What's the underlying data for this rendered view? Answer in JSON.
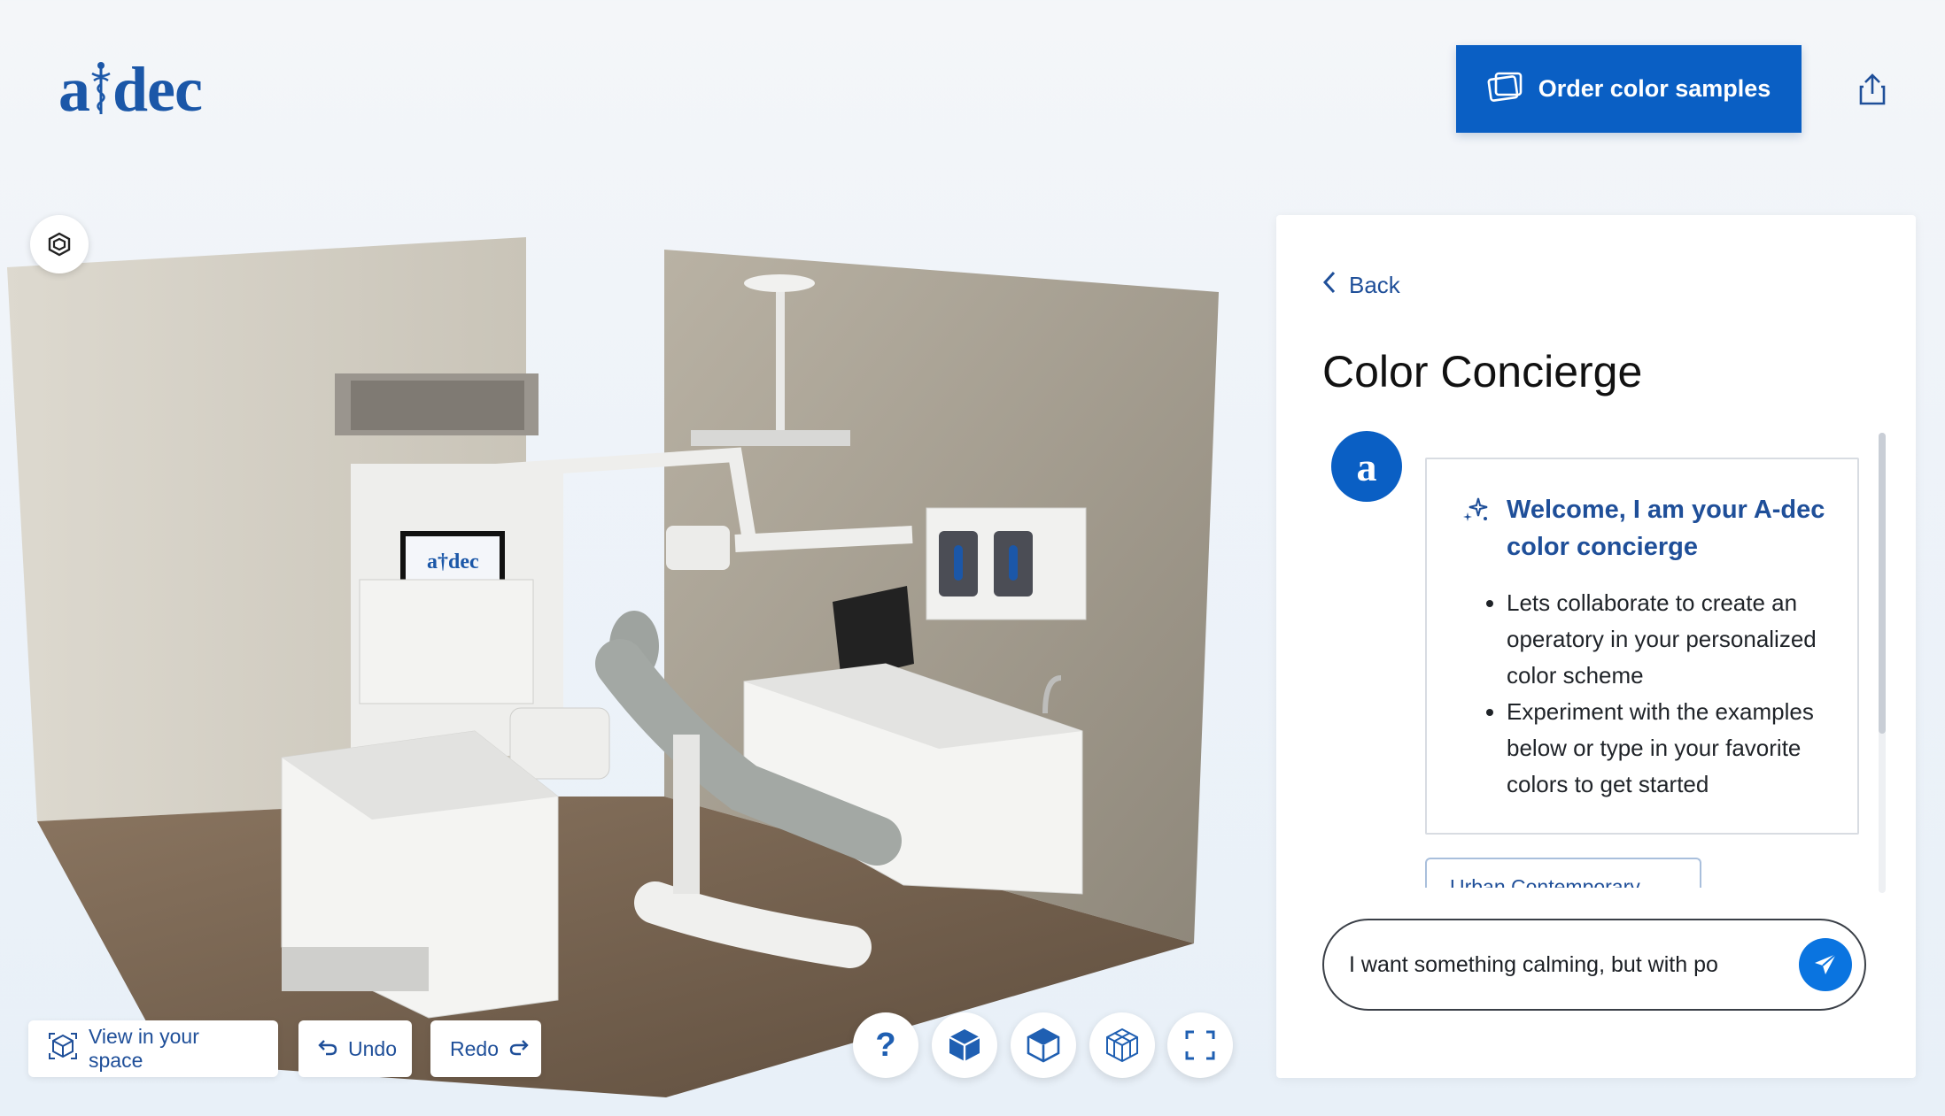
{
  "header": {
    "logo_text_left": "a",
    "logo_text_right": "dec",
    "order_button_label": "Order color samples",
    "order_icon": "swatch-icon",
    "share_icon": "share-icon"
  },
  "viewport": {
    "ar_icon": "ar-icon",
    "monitor_logo": "a†dec",
    "bottom_buttons": {
      "view_in_space": "View in your space",
      "undo": "Undo",
      "redo": "Redo"
    },
    "tools": {
      "help": "?",
      "cube_icons": [
        "cube-solid-icon",
        "cube-top-icon",
        "cube-wireframe-icon"
      ],
      "fullscreen_icon": "fullscreen-icon"
    }
  },
  "panel": {
    "back_label": "Back",
    "title": "Color Concierge",
    "avatar_letter": "a",
    "welcome_title": "Welcome, I am your A-dec color concierge",
    "bullets": [
      "Lets collaborate to create an operatory in your personalized color scheme",
      "Experiment with the examples below or type in your favorite colors to get started"
    ],
    "suggestion_chip": "Urban Contemporary",
    "input_value": "I want something calming, but with po",
    "send_icon": "send-icon"
  },
  "colors": {
    "brand_blue": "#0a5fc4",
    "link_blue": "#1f4f99",
    "send_blue": "#0a74e0"
  }
}
